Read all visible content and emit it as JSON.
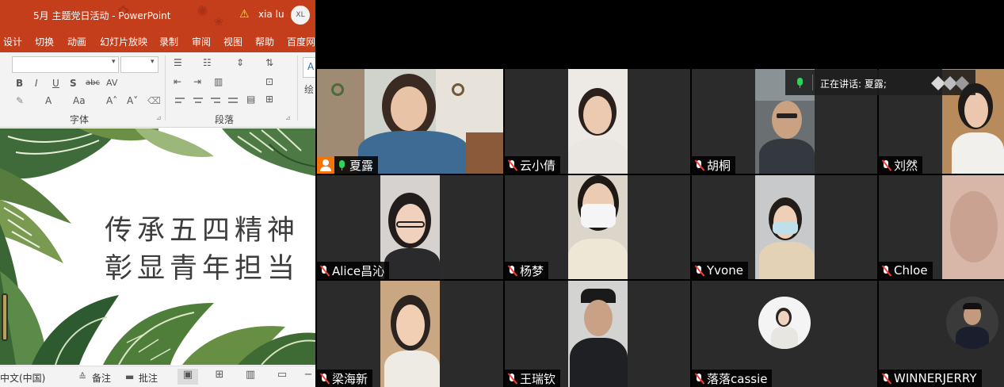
{
  "powerpoint": {
    "window_title": "5月 主题党日活动  -  PowerPoint",
    "user_name": "xia lu",
    "user_initials": "XL",
    "menu": [
      "设计",
      "切换",
      "动画",
      "幻灯片放映",
      "录制",
      "审阅",
      "视图",
      "帮助",
      "百度网"
    ],
    "ribbon": {
      "font_group_label": "字体",
      "paragraph_group_label": "段落",
      "draw_label": "绘",
      "bold": "B",
      "italic": "I",
      "underline": "U",
      "shadow": "S",
      "strike": "abc",
      "spacing": "AV",
      "font_color": "A",
      "case": "Aa",
      "grow": "A˄",
      "shrink": "A˅"
    },
    "slide": {
      "line1": "传承五四精神",
      "line2": "彰显青年担当"
    },
    "status_bar": {
      "language": "中文(中国)",
      "notes": "备注",
      "comments": "批注"
    }
  },
  "meeting": {
    "speaking_indicator": "正在讲话: 夏露;",
    "participants": [
      {
        "name": "夏露",
        "muted": false,
        "host": true
      },
      {
        "name": "云小倩",
        "muted": true
      },
      {
        "name": "胡桐",
        "muted": true
      },
      {
        "name": "刘然",
        "muted": true
      },
      {
        "name": "Alice昌沁",
        "muted": true
      },
      {
        "name": "杨梦",
        "muted": true
      },
      {
        "name": "Yvone",
        "muted": true
      },
      {
        "name": "Chloe",
        "muted": true
      },
      {
        "name": "梁海新",
        "muted": true
      },
      {
        "name": "王瑞钦",
        "muted": true
      },
      {
        "name": "落落cassie",
        "muted": true
      },
      {
        "name": "WINNERJERRY",
        "muted": true
      }
    ]
  },
  "colors": {
    "ppt_accent": "#c43e1c",
    "active_speaker_border": "#23d959",
    "tile_bg": "#2b2b2b",
    "mute_red": "#ff3b30",
    "host_orange": "#f2750c"
  }
}
